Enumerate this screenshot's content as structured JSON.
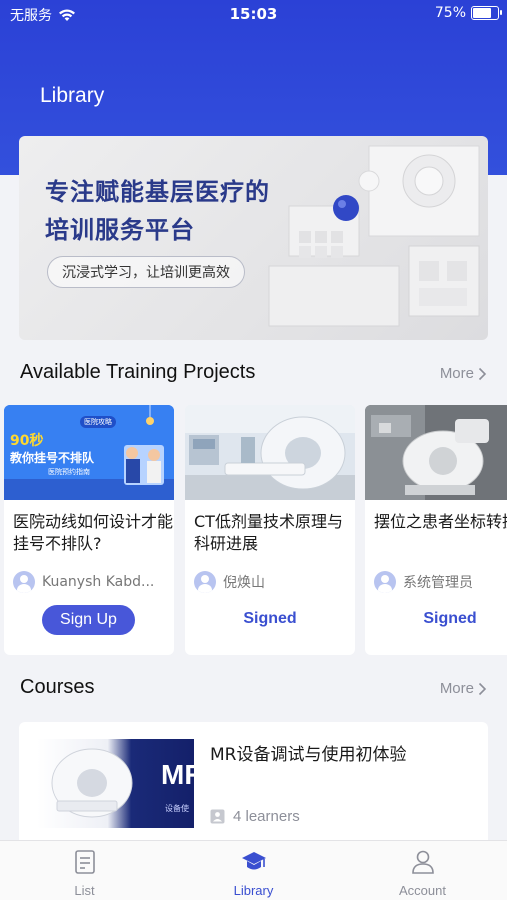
{
  "status_bar": {
    "carrier": "无服务",
    "time": "15:03",
    "battery": "75%",
    "battery_level": 0.75
  },
  "page_title": "Library",
  "banner": {
    "headline_line1": "专注赋能基层医疗的",
    "headline_line2": "培训服务平台",
    "tagline": "沉浸式学习，让培训更高效"
  },
  "training": {
    "section_title": "Available Training Projects",
    "more_label": "More",
    "cards": [
      {
        "title": "医院动线如何设计才能挂号不排队?",
        "author": "Kuanysh Kabd...",
        "action": "Sign Up",
        "thumb_text": [
          "90秒",
          "教你挂号不排队",
          "医院预约指南",
          "医院攻略"
        ]
      },
      {
        "title": "CT低剂量技术原理与科研进展",
        "author": "倪焕山",
        "action": "Signed"
      },
      {
        "title": "摆位之患者坐标转换",
        "author": "系统管理员",
        "action": "Signed"
      }
    ]
  },
  "courses": {
    "section_title": "Courses",
    "more_label": "More",
    "items": [
      {
        "title": "MR设备调试与使用初体验",
        "learners": "4 learners",
        "thumb_text": "MR",
        "thumb_sub": "设备使"
      }
    ]
  },
  "tabbar": {
    "tabs": [
      {
        "label": "List",
        "icon": "list-icon"
      },
      {
        "label": "Library",
        "icon": "graduation-cap-icon"
      },
      {
        "label": "Account",
        "icon": "user-icon"
      }
    ],
    "active_index": 1
  },
  "colors": {
    "brand_blue": "#2b41d6",
    "accent": "#4857d9",
    "muted_text": "#8d8f99"
  }
}
